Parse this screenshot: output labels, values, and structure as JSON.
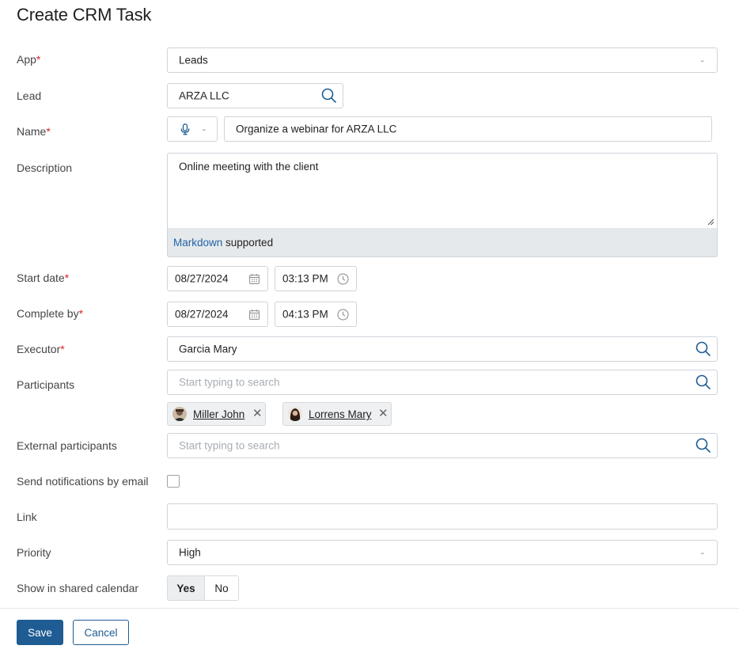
{
  "page": {
    "title": "Create CRM Task"
  },
  "form": {
    "app": {
      "label": "App",
      "value": "Leads"
    },
    "lead": {
      "label": "Lead",
      "value": "ARZA LLC"
    },
    "name": {
      "label": "Name",
      "value": "Organize a webinar for ARZA LLC"
    },
    "description": {
      "label": "Description",
      "value": "Online meeting with the client",
      "markdown_link": "Markdown",
      "markdown_suffix": " supported"
    },
    "start_date": {
      "label": "Start date",
      "date": "08/27/2024",
      "time": "03:13 PM"
    },
    "complete_by": {
      "label": "Complete by",
      "date": "08/27/2024",
      "time": "04:13 PM"
    },
    "executor": {
      "label": "Executor",
      "value": "Garcia Mary"
    },
    "participants": {
      "label": "Participants",
      "placeholder": "Start typing to search",
      "chips": [
        {
          "name": "Miller John"
        },
        {
          "name": "Lorrens Mary"
        }
      ]
    },
    "external_participants": {
      "label": "External participants",
      "placeholder": "Start typing to search"
    },
    "send_notifications": {
      "label": "Send notifications by email",
      "checked": false
    },
    "link": {
      "label": "Link",
      "value": ""
    },
    "priority": {
      "label": "Priority",
      "value": "High"
    },
    "shared_calendar": {
      "label": "Show in shared calendar",
      "options": [
        "Yes",
        "No"
      ],
      "selected": "Yes"
    }
  },
  "actions": {
    "save": "Save",
    "cancel": "Cancel"
  },
  "colors": {
    "accent": "#1e5c93",
    "required": "#d9252a",
    "link": "#1e63a5"
  }
}
